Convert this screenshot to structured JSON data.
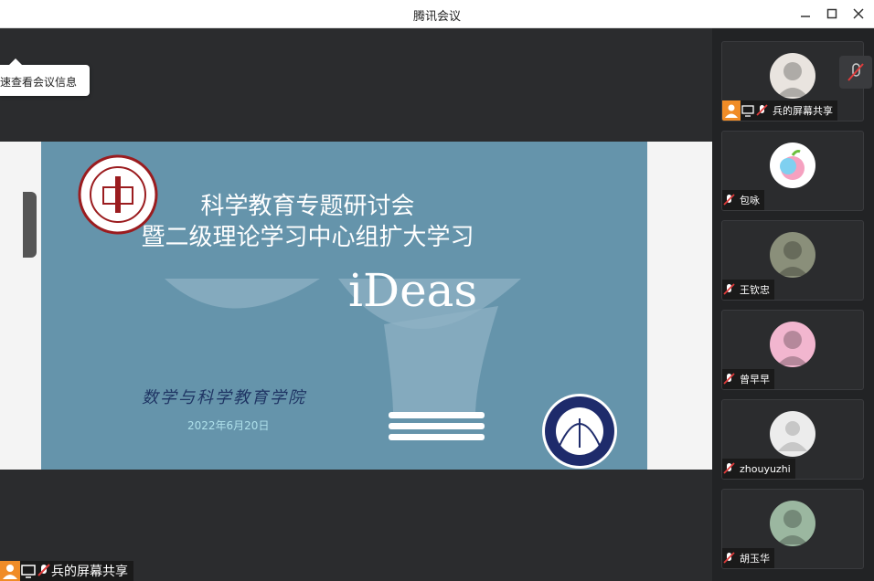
{
  "window": {
    "title": "腾讯会议"
  },
  "tooltip": {
    "text": "速查看会议信息"
  },
  "slide": {
    "title_line1": "科学教育专题研讨会",
    "title_line2": "暨二级理论学习中心组扩大学习",
    "ideas_text": "iDeas",
    "school_name": "数学与科学教育学院",
    "date": "2022年6月20日"
  },
  "bottom_bar": {
    "label": "兵的屏幕共享"
  },
  "participants": [
    {
      "name": "兵的屏幕共享",
      "avatar_icon": "cartoon-cow-avatar",
      "sharing": true
    },
    {
      "name": "包咏",
      "avatar_icon": "apple-logo-avatar",
      "sharing": false
    },
    {
      "name": "王钦忠",
      "avatar_icon": "child-photo-avatar",
      "sharing": false
    },
    {
      "name": "曾早早",
      "avatar_icon": "cartoon-girl-avatar",
      "sharing": false
    },
    {
      "name": "zhouyuzhi",
      "avatar_icon": "default-user-avatar",
      "sharing": false
    },
    {
      "name": "胡玉华",
      "avatar_icon": "person-photo-avatar",
      "sharing": false
    }
  ],
  "colors": {
    "slide_bg": "#6594ab",
    "sidebar_bg": "#222325",
    "share_orange": "#f08c27",
    "mute_red": "#e03b3b"
  }
}
